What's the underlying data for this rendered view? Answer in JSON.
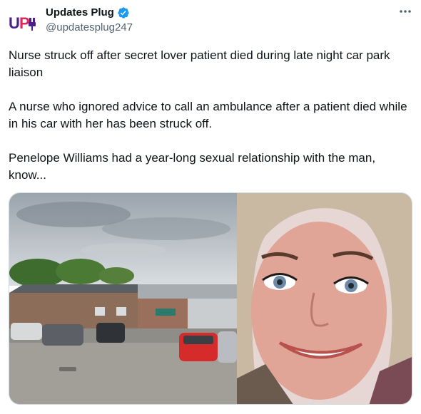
{
  "author": {
    "display_name": "Updates Plug",
    "handle": "@updatesplug247",
    "avatar_text": "UP",
    "verified": true
  },
  "tweet": {
    "paragraphs": [
      "Nurse struck off after secret lover patient died during late night car park liaison",
      "A nurse who ignored advice to call an ambulance after a patient died while in his car with her has been struck off.",
      "Penelope Williams had a year-long sexual relationship with the man, know..."
    ]
  },
  "media": {
    "images": [
      {
        "icon": "hospital-car-park-photo"
      },
      {
        "icon": "woman-selfie-photo"
      }
    ]
  },
  "colors": {
    "verified_blue": "#1d9bf0",
    "secondary_text": "#536471",
    "logo_purple": "#4b1e8c",
    "logo_red": "#e0245e"
  }
}
